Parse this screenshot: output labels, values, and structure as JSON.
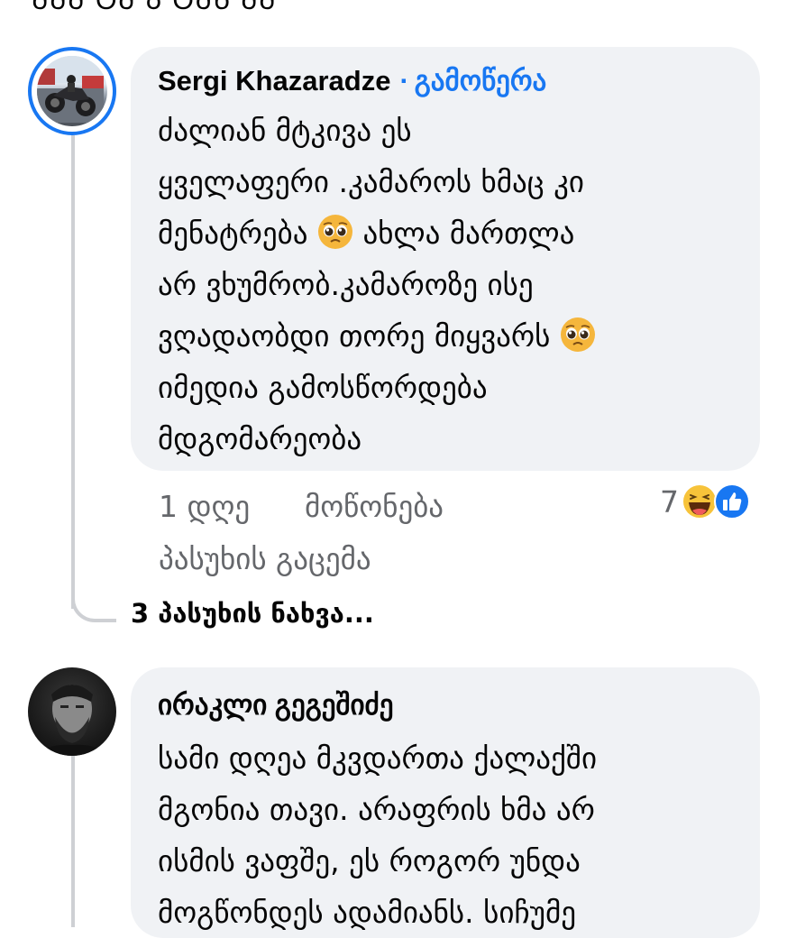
{
  "clipped_top_text": "ᲛᲛᲛ ᲢᲛ Ა ᲢᲛᲬ ᲛᲛ",
  "comments": [
    {
      "author": "Sergi Khazaradze",
      "separator": "·",
      "follow_label": "გამოწერა",
      "lines": [
        "ძალიან მტკივა ეს",
        "ყველაფერი .კამაროს ხმაც კი",
        "მენატრება",
        "ახლა მართლა",
        "არ ვხუმრობ.კამაროზე ისე",
        "ვღადაობდი თორე მიყვარს",
        "იმედია გამოსწორდება",
        "მდგომარეობა"
      ],
      "time": "1 დღე",
      "like_label": "მოწონება",
      "reply_label": "პასუხის გაცემა",
      "reaction_count": "7",
      "reaction_icons": [
        "haha-icon",
        "like-icon"
      ],
      "view_replies_label": "3 პასუხის ნახვა..."
    },
    {
      "author": "ირაკლი გეგეშიძე",
      "lines": [
        "სამი დღეა მკვდართა ქალაქში",
        "მგონია თავი. არაფრის ხმა არ",
        "ისმის ვაფშე, ეს როგორ უნდა",
        "მოგწონდეს ადამიანს. სიჩუმე"
      ]
    }
  ],
  "colors": {
    "bubble": "#f0f2f5",
    "accent": "#1877f2",
    "secondary_text": "#65676b",
    "thread_line": "#ced0d4"
  }
}
